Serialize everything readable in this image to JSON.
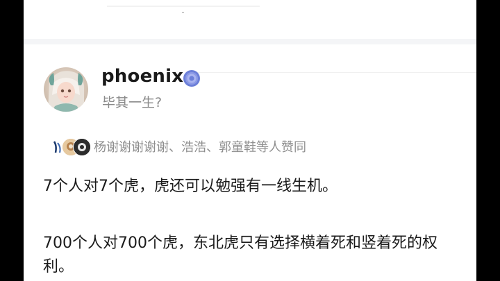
{
  "answer": {
    "author": {
      "name": "phoenix",
      "bio": "毕其一生?"
    },
    "voters_text": "杨谢谢谢谢谢、浩浩、郭童鞋等人赞同",
    "paragraphs": [
      "7个人对7个虎，虎还可以勉强有一线生机。",
      "700个人对700个虎，东北虎只有选择横着死和竖着死的权利。"
    ]
  },
  "colors": {
    "page_bg": "#ffffff",
    "text": "#1a1a1a",
    "muted": "#8a8a8a",
    "verify_badge": "#6c7fd8"
  },
  "icons": {
    "verify": "verified-badge-icon",
    "avatar": "user-avatar"
  }
}
